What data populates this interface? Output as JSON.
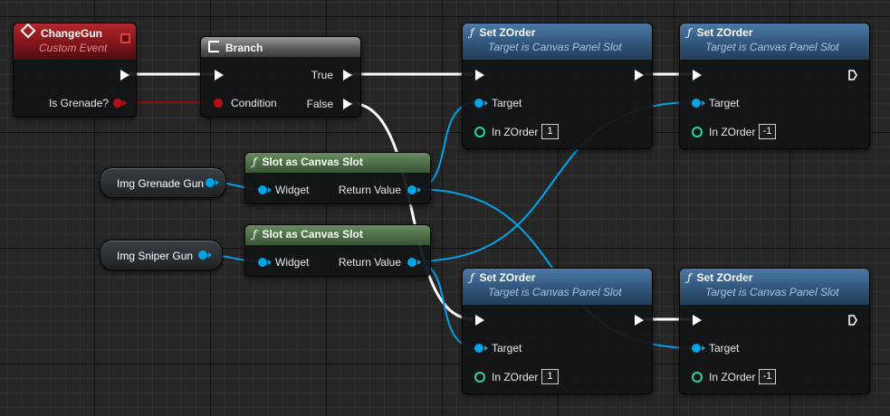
{
  "nodes": {
    "change_gun": {
      "title": "ChangeGun",
      "subtitle": "Custom Event",
      "pin_label": "Is Grenade?"
    },
    "branch": {
      "title": "Branch",
      "condition": "Condition",
      "true_label": "True",
      "false_label": "False"
    },
    "slot_1": {
      "title": "Slot as Canvas Slot",
      "widget": "Widget",
      "return": "Return Value"
    },
    "slot_2": {
      "title": "Slot as Canvas Slot",
      "widget": "Widget",
      "return": "Return Value"
    },
    "img_grenade": {
      "label": "Img Grenade Gun"
    },
    "img_sniper": {
      "label": "Img Sniper Gun"
    },
    "set_z1": {
      "title": "Set ZOrder",
      "subtitle": "Target is Canvas Panel Slot",
      "target": "Target",
      "zlabel": "In ZOrder",
      "zvalue": "1"
    },
    "set_z2": {
      "title": "Set ZOrder",
      "subtitle": "Target is Canvas Panel Slot",
      "target": "Target",
      "zlabel": "In ZOrder",
      "zvalue": "-1"
    },
    "set_z3": {
      "title": "Set ZOrder",
      "subtitle": "Target is Canvas Panel Slot",
      "target": "Target",
      "zlabel": "In ZOrder",
      "zvalue": "1"
    },
    "set_z4": {
      "title": "Set ZOrder",
      "subtitle": "Target is Canvas Panel Slot",
      "target": "Target",
      "zlabel": "In ZOrder",
      "zvalue": "-1"
    }
  },
  "icons": {
    "function": "ƒ",
    "event": "event-diamond-icon",
    "branch": "branch-icon"
  },
  "colors": {
    "exec_wire": "#ffffff",
    "object_wire": "#00a4e8",
    "bool_wire": "#8a0d12",
    "integer_pin": "#2bd3a6",
    "event_header": "#b3262b",
    "function_header": "#2e5276",
    "pure_header": "#4a6a44"
  }
}
